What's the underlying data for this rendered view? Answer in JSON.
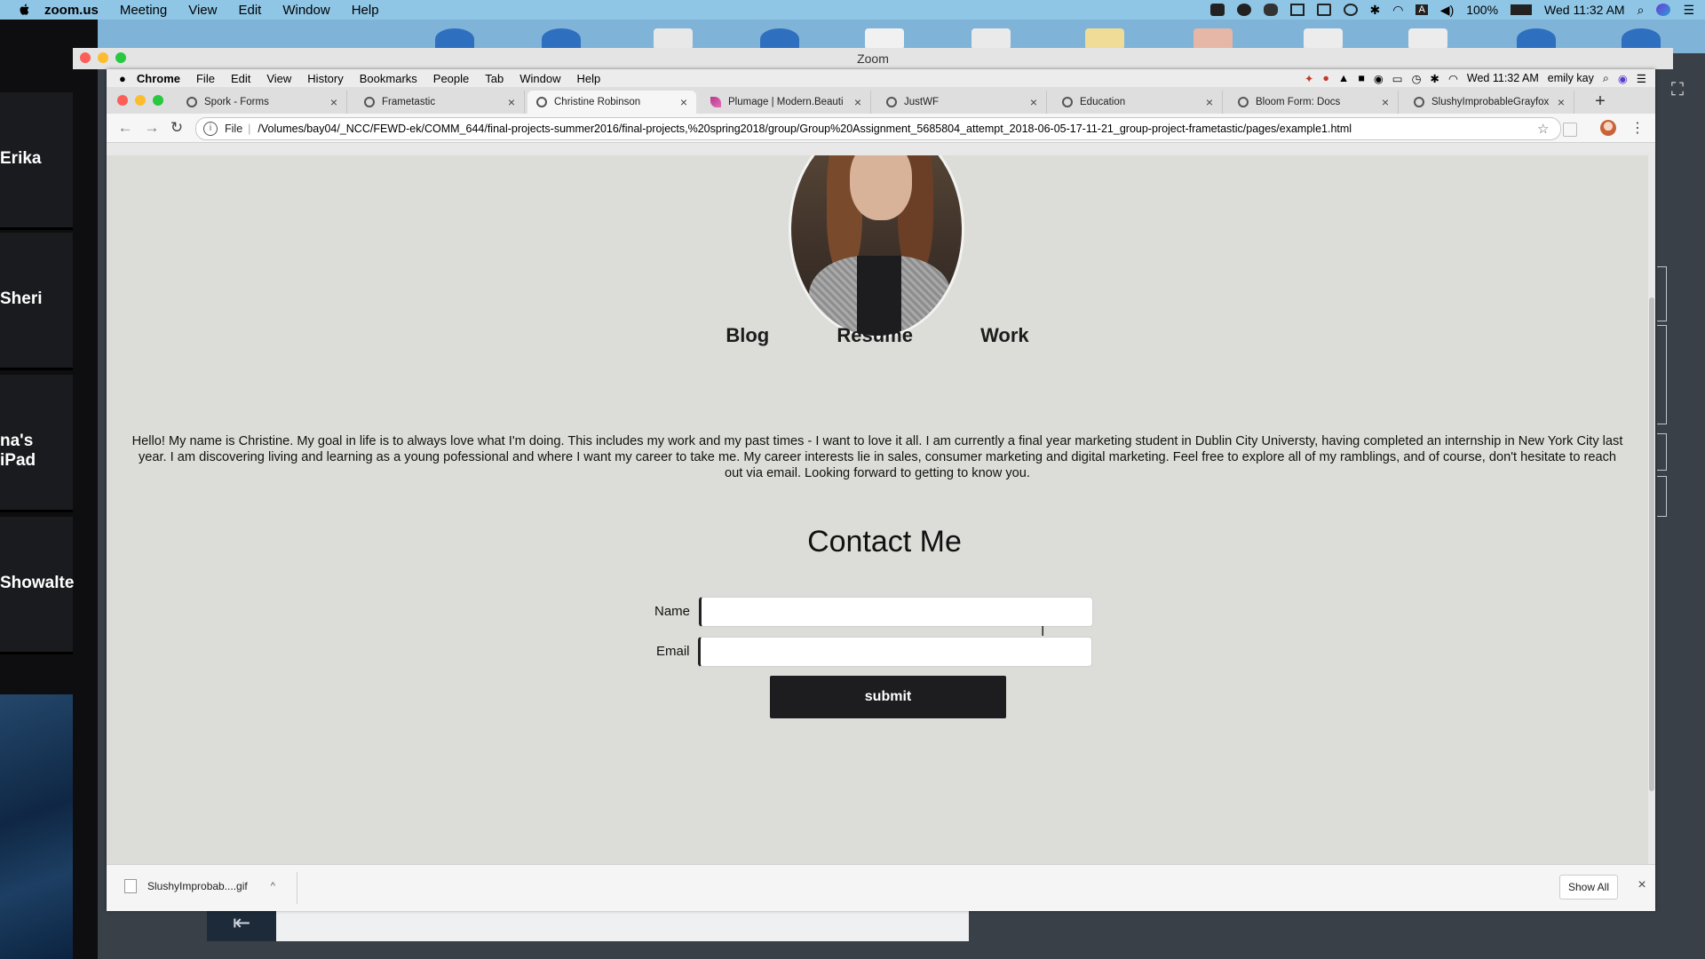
{
  "mac": {
    "app_name": "zoom.us",
    "menu": [
      "Meeting",
      "View",
      "Edit",
      "Window",
      "Help"
    ],
    "battery": "100%",
    "clock": "Wed 11:32 AM"
  },
  "zoom": {
    "window_title": "Zoom",
    "participants": [
      "Erika",
      "Sheri",
      "na's iPad",
      "Showalte"
    ]
  },
  "chrome": {
    "app_menu": [
      "Chrome",
      "File",
      "Edit",
      "View",
      "History",
      "Bookmarks",
      "People",
      "Tab",
      "Window",
      "Help"
    ],
    "clock": "Wed 11:32 AM",
    "user": "emily kay",
    "tabs": [
      {
        "label": "Spork - Forms",
        "active": false
      },
      {
        "label": "Frametastic",
        "active": false
      },
      {
        "label": "Christine Robinson",
        "active": true
      },
      {
        "label": "Plumage | Modern.Beauti",
        "active": false
      },
      {
        "label": "JustWF",
        "active": false
      },
      {
        "label": "Education",
        "active": false
      },
      {
        "label": "Bloom Form: Docs",
        "active": false
      },
      {
        "label": "SlushyImprobableGrayfox",
        "active": false
      }
    ],
    "omnibox": {
      "scheme": "File",
      "url": "/Volumes/bay04/_NCC/FEWD-ek/COMM_644/final-projects-summer2016/final-projects,%20spring2018/group/Group%20Assignment_5685804_attempt_2018-06-05-17-11-21_group-project-frametastic/pages/example1.html"
    }
  },
  "page": {
    "nav": [
      "Blog",
      "Resume",
      "Work"
    ],
    "bio": "Hello! My name is Christine. My goal in life is to always love what I'm doing. This includes my work and my past times - I want to love it all. I am currently a final year marketing student in Dublin City Universty, having completed an internship in New York City last year. I am discovering living and learning as a young pofessional and where I want my career to take me. My career interests lie in sales, consumer marketing and digital marketing. Feel free to explore all of my ramblings, and of course, don't hesitate to reach out via email. Looking forward to getting to know you.",
    "contact": {
      "title": "Contact Me",
      "name_label": "Name",
      "email_label": "Email",
      "name_value": "",
      "email_value": "",
      "submit_label": "submit"
    }
  },
  "downloads": {
    "file": "SlushyImprobab....gif",
    "show_all": "Show All"
  }
}
